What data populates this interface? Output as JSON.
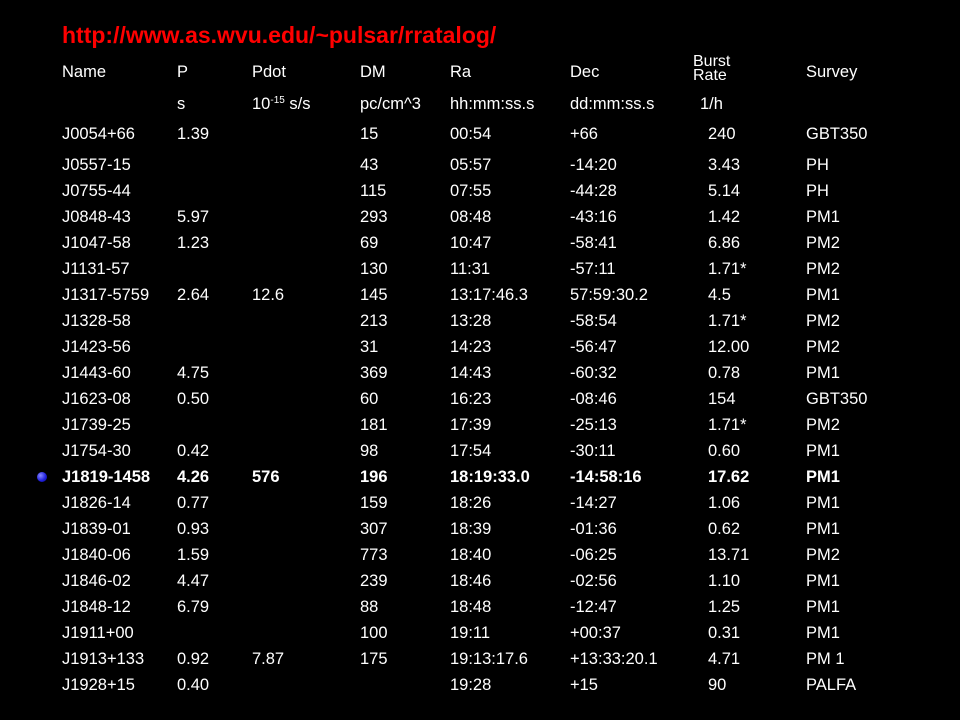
{
  "slide": {
    "title": "http://www.as.wvu.edu/~pulsar/rratalog/"
  },
  "table": {
    "headers": {
      "name": "Name",
      "p": "P",
      "pdot": "Pdot",
      "dm": "DM",
      "ra": "Ra",
      "dec": "Dec",
      "burst_line1": "Burst",
      "burst_line2": "Rate",
      "survey": "Survey"
    },
    "units": {
      "p": "s",
      "pdot_base": "10",
      "pdot_exp": "-15",
      "pdot_unit": " s/s",
      "dm": "pc/cm^3",
      "ra": "hh:mm:ss.s",
      "dec": "dd:mm:ss.s",
      "burst": "1/h"
    },
    "highlight_row": 13,
    "rows": [
      {
        "name": "J0054+66",
        "p": "1.39",
        "pdot": "",
        "dm": "15",
        "ra": "00:54",
        "dec": "+66",
        "burst": "240",
        "survey": "GBT350"
      },
      {
        "name": "J0557-15",
        "p": "",
        "pdot": "",
        "dm": "43",
        "ra": "05:57",
        "dec": "-14:20",
        "burst": "3.43",
        "survey": "PH"
      },
      {
        "name": "J0755-44",
        "p": "",
        "pdot": "",
        "dm": "115",
        "ra": "07:55",
        "dec": "-44:28",
        "burst": "5.14",
        "survey": "PH"
      },
      {
        "name": "J0848-43",
        "p": "5.97",
        "pdot": "",
        "dm": "293",
        "ra": "08:48",
        "dec": "-43:16",
        "burst": "1.42",
        "survey": "PM1"
      },
      {
        "name": "J1047-58",
        "p": "1.23",
        "pdot": "",
        "dm": "69",
        "ra": "10:47",
        "dec": "-58:41",
        "burst": "6.86",
        "survey": "PM2"
      },
      {
        "name": "J1131-57",
        "p": "",
        "pdot": "",
        "dm": "130",
        "ra": "11:31",
        "dec": "-57:11",
        "burst": "1.71*",
        "survey": "PM2"
      },
      {
        "name": "J1317-5759",
        "p": "2.64",
        "pdot": "12.6",
        "dm": "145",
        "ra": "13:17:46.3",
        "dec": "57:59:30.2",
        "burst": "4.5",
        "survey": "PM1"
      },
      {
        "name": "J1328-58",
        "p": "",
        "pdot": "",
        "dm": "213",
        "ra": "13:28",
        "dec": "-58:54",
        "burst": "1.71*",
        "survey": "PM2"
      },
      {
        "name": "J1423-56",
        "p": "",
        "pdot": "",
        "dm": "31",
        "ra": "14:23",
        "dec": "-56:47",
        "burst": "12.00",
        "survey": "PM2"
      },
      {
        "name": "J1443-60",
        "p": "4.75",
        "pdot": "",
        "dm": "369",
        "ra": "14:43",
        "dec": "-60:32",
        "burst": "0.78",
        "survey": "PM1"
      },
      {
        "name": "J1623-08",
        "p": "0.50",
        "pdot": "",
        "dm": "60",
        "ra": "16:23",
        "dec": "-08:46",
        "burst": "154",
        "survey": "GBT350"
      },
      {
        "name": "J1739-25",
        "p": "",
        "pdot": "",
        "dm": "181",
        "ra": "17:39",
        "dec": "-25:13",
        "burst": "1.71*",
        "survey": "PM2"
      },
      {
        "name": "J1754-30",
        "p": "0.42",
        "pdot": "",
        "dm": "98",
        "ra": "17:54",
        "dec": "-30:11",
        "burst": "0.60",
        "survey": "PM1"
      },
      {
        "name": "J1819-1458",
        "p": "4.26",
        "pdot": "576",
        "dm": "196",
        "ra": "18:19:33.0",
        "dec": "-14:58:16",
        "burst": "17.62",
        "survey": "PM1"
      },
      {
        "name": "J1826-14",
        "p": "0.77",
        "pdot": "",
        "dm": "159",
        "ra": "18:26",
        "dec": "-14:27",
        "burst": "1.06",
        "survey": "PM1"
      },
      {
        "name": "J1839-01",
        "p": "0.93",
        "pdot": "",
        "dm": "307",
        "ra": "18:39",
        "dec": "-01:36",
        "burst": "0.62",
        "survey": "PM1"
      },
      {
        "name": "J1840-06",
        "p": "1.59",
        "pdot": "",
        "dm": "773",
        "ra": "18:40",
        "dec": "-06:25",
        "burst": "13.71",
        "survey": "PM2"
      },
      {
        "name": "J1846-02",
        "p": "4.47",
        "pdot": "",
        "dm": "239",
        "ra": "18:46",
        "dec": "-02:56",
        "burst": "1.10",
        "survey": "PM1"
      },
      {
        "name": "J1848-12",
        "p": "6.79",
        "pdot": "",
        "dm": "88",
        "ra": "18:48",
        "dec": "-12:47",
        "burst": "1.25",
        "survey": "PM1"
      },
      {
        "name": "J1911+00",
        "p": "",
        "pdot": "",
        "dm": "100",
        "ra": "19:11",
        "dec": "+00:37",
        "burst": "0.31",
        "survey": "PM1"
      },
      {
        "name": "J1913+133",
        "p": "0.92",
        "pdot": "7.87",
        "dm": "175",
        "ra": "19:13:17.6",
        "dec": "+13:33:20.1",
        "burst": "4.71",
        "survey": "PM 1"
      },
      {
        "name": "J1928+15",
        "p": "0.40",
        "pdot": "",
        "dm": "",
        "ra": "19:28",
        "dec": "+15",
        "burst": "90",
        "survey": "PALFA"
      }
    ]
  },
  "colors": {
    "background": "#000000",
    "title": "#ff0000",
    "text": "#ffffff",
    "bullet": "#2222dd"
  }
}
